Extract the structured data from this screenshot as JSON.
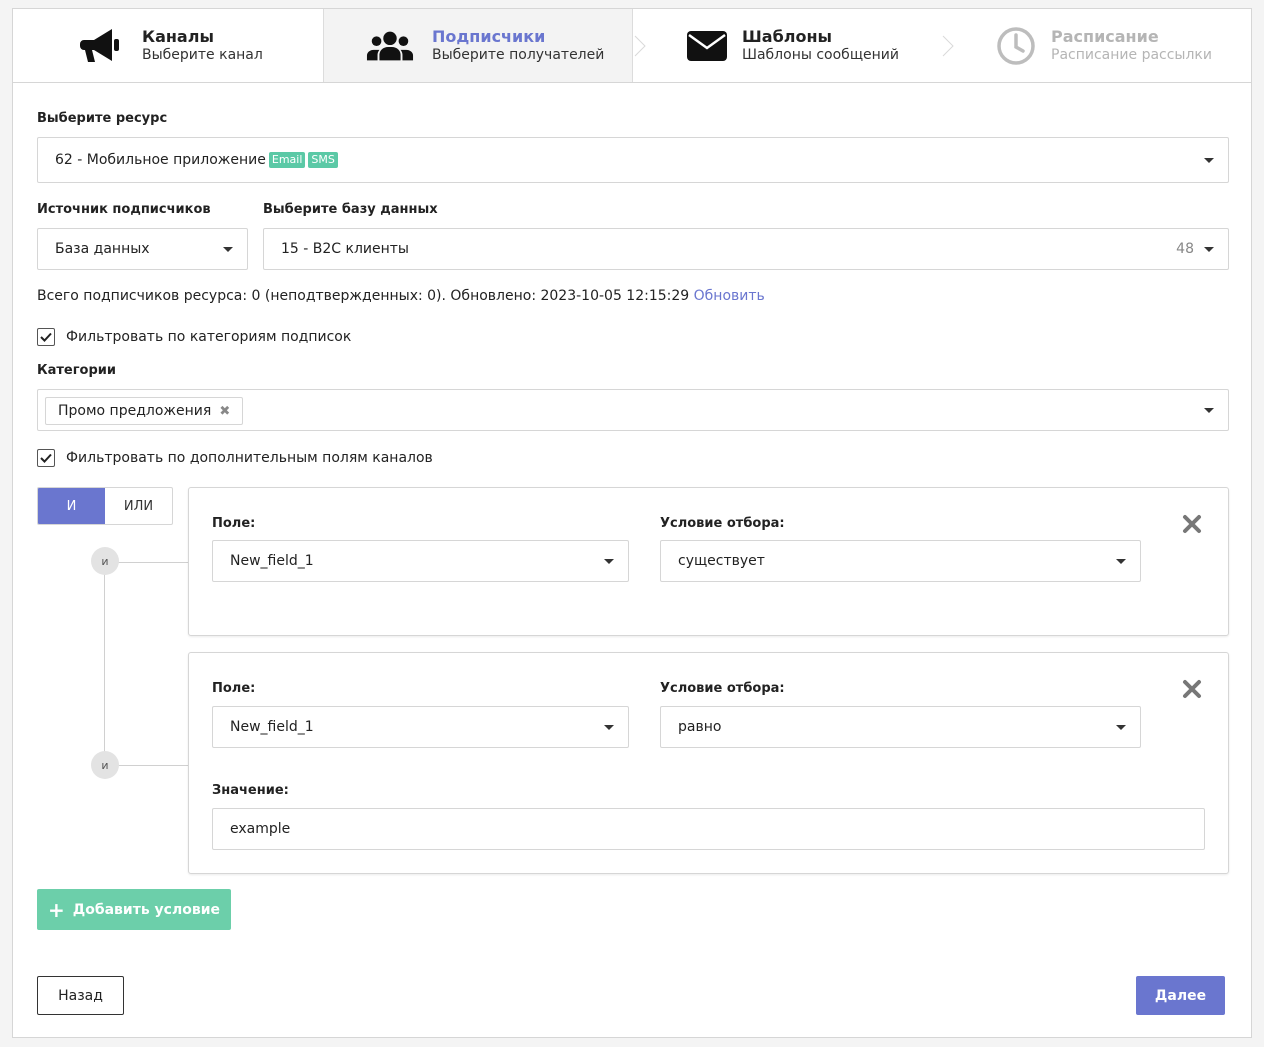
{
  "steps": [
    {
      "title": "Каналы",
      "subtitle": "Выберите канал",
      "icon": "megaphone-icon"
    },
    {
      "title": "Подписчики",
      "subtitle": "Выберите получателей",
      "icon": "users-icon"
    },
    {
      "title": "Шаблоны",
      "subtitle": "Шаблоны сообщений",
      "icon": "envelope-icon"
    },
    {
      "title": "Расписание",
      "subtitle": "Расписание рассылки",
      "icon": "clock-icon"
    }
  ],
  "resource": {
    "label": "Выберите ресурс",
    "value": "62 - Мобильное приложение",
    "badges": [
      "Email",
      "SMS"
    ]
  },
  "source": {
    "label": "Источник подписчиков",
    "value": "База данных"
  },
  "database": {
    "label": "Выберите базу данных",
    "value": "15 - B2C клиенты",
    "count": "48"
  },
  "info": {
    "text": "Всего подписчиков ресурса: 0 (неподтвержденных: 0). Обновлено: 2023-10-05 12:15:29",
    "link": "Обновить"
  },
  "filter_categories": {
    "label": "Фильтровать по категориям подписок",
    "checked": true
  },
  "categories": {
    "label": "Категории",
    "tags": [
      "Промо предложения"
    ]
  },
  "filter_fields": {
    "label": "Фильтровать по дополнительным полям каналов",
    "checked": true
  },
  "logic": {
    "and": "И",
    "or": "ИЛИ",
    "node": "и"
  },
  "conditions": [
    {
      "field_label": "Поле:",
      "field_value": "New_field_1",
      "cond_label": "Условие отбора:",
      "cond_value": "существует"
    },
    {
      "field_label": "Поле:",
      "field_value": "New_field_1",
      "cond_label": "Условие отбора:",
      "cond_value": "равно",
      "value_label": "Значение:",
      "value": "example"
    }
  ],
  "buttons": {
    "add": "Добавить условие",
    "back": "Назад",
    "next": "Далее"
  },
  "colors": {
    "accent": "#6a76cf",
    "success": "#6ccfaa",
    "badge": "#5bc9a6"
  }
}
